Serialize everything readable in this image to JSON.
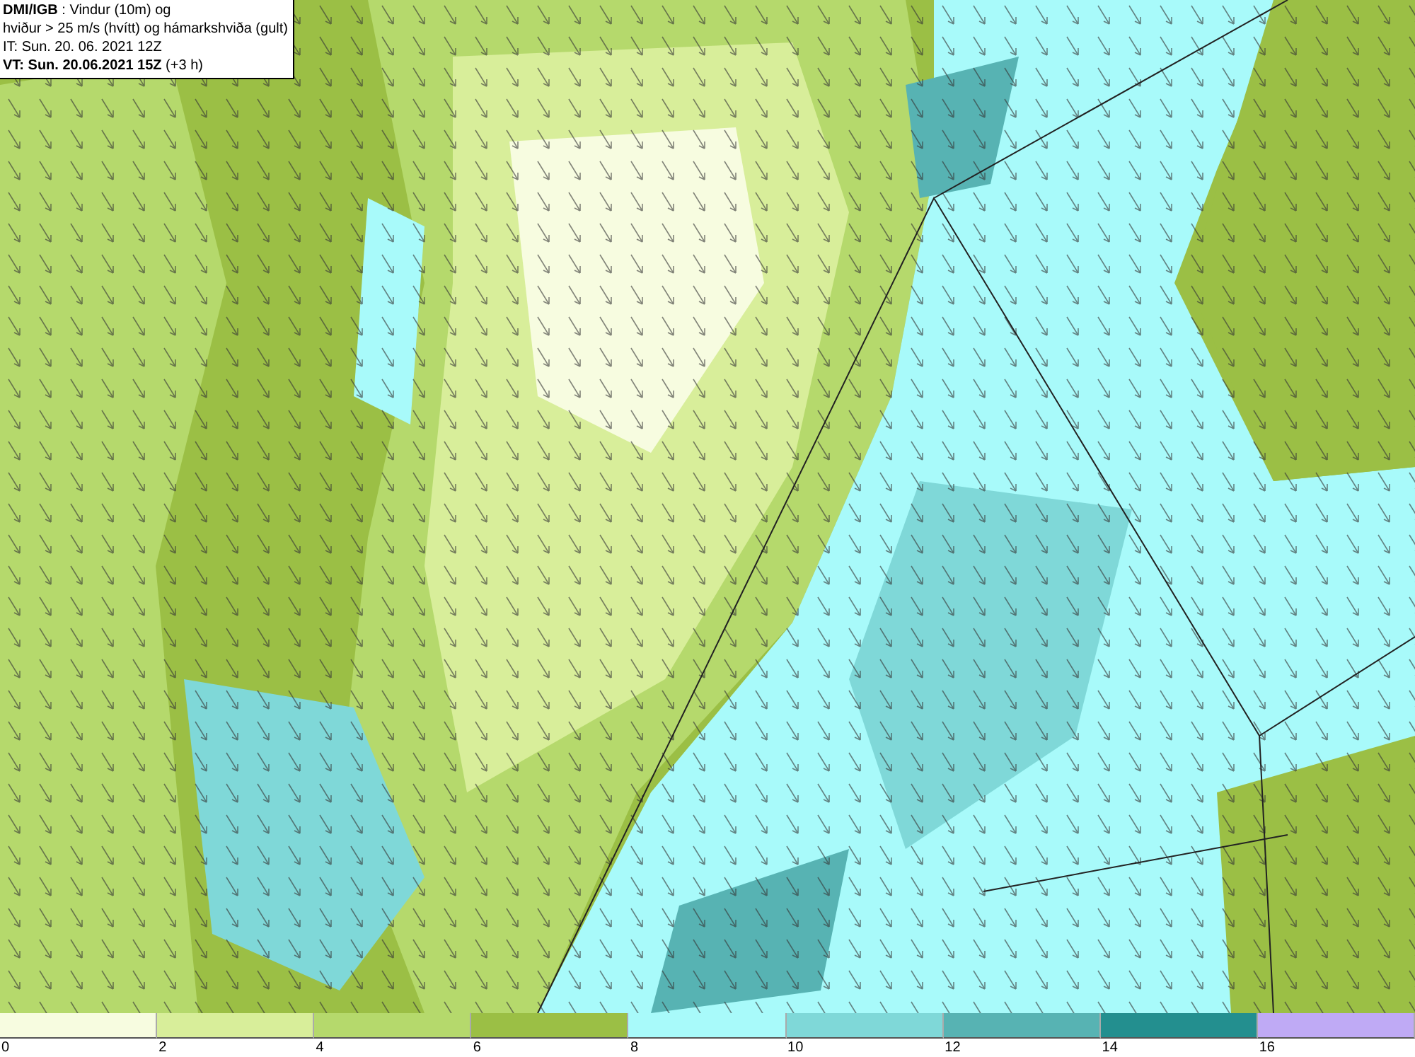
{
  "header": {
    "lines": [
      "**DMI/IGB** : Vindur (10m) og",
      "hviður > 25 m/s (hvítt) og hámarkshviða (gult)",
      "IT: Sun. 20. 06. 2021 12Z",
      "**VT: Sun. 20.06.2021 15Z** (+3 h)"
    ]
  },
  "legend": [
    {
      "label": "0",
      "color": "#f7fce0"
    },
    {
      "label": "2",
      "color": "#d8ee9a"
    },
    {
      "label": "4",
      "color": "#b5d96c"
    },
    {
      "label": "6",
      "color": "#9bbf45"
    },
    {
      "label": "8",
      "color": "#a8fafa"
    },
    {
      "label": "10",
      "color": "#7fd8d8"
    },
    {
      "label": "12",
      "color": "#57b3b3"
    },
    {
      "label": "14",
      "color": "#238f8f"
    },
    {
      "label": "16",
      "color": "#bfaaf5"
    }
  ]
}
